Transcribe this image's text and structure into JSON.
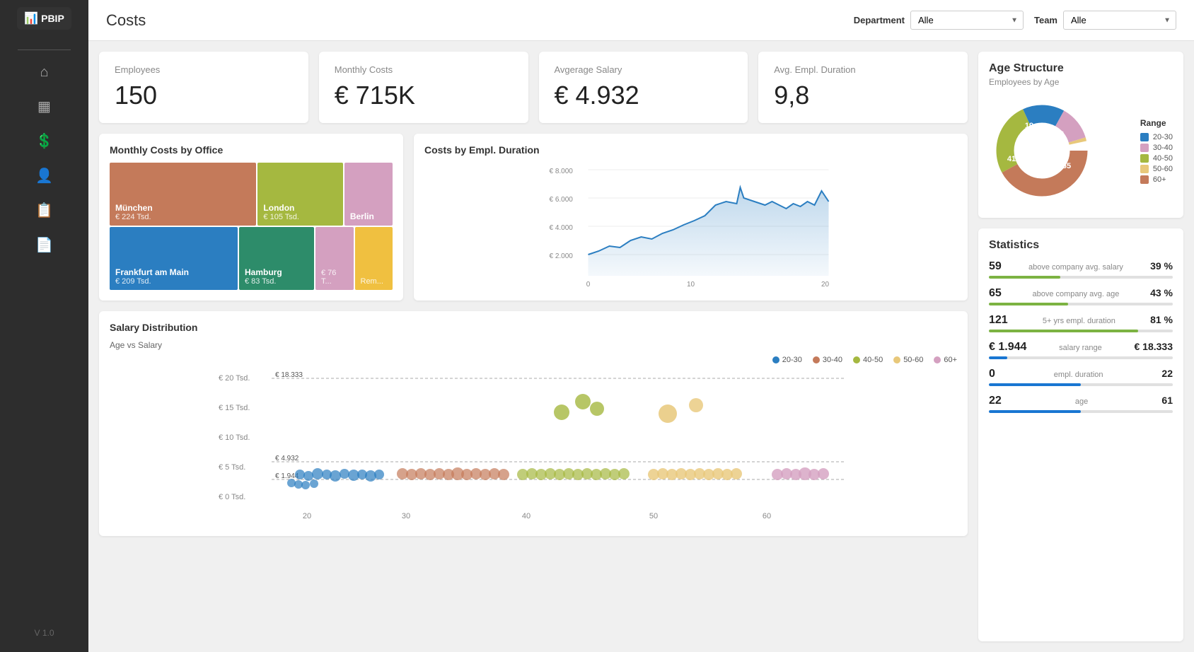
{
  "sidebar": {
    "logo": "PBIP",
    "version": "V 1.0",
    "items": [
      {
        "name": "home",
        "icon": "⌂",
        "active": false
      },
      {
        "name": "calendar",
        "icon": "📅",
        "active": false
      },
      {
        "name": "costs",
        "icon": "💲",
        "active": true
      },
      {
        "name": "person",
        "icon": "👤",
        "active": false
      },
      {
        "name": "report",
        "icon": "📋",
        "active": false
      },
      {
        "name": "document",
        "icon": "📄",
        "active": false
      }
    ]
  },
  "header": {
    "title": "Costs",
    "department_label": "Department",
    "department_value": "Alle",
    "team_label": "Team",
    "team_value": "Alle"
  },
  "kpis": [
    {
      "label": "Employees",
      "value": "150"
    },
    {
      "label": "Monthly Costs",
      "value": "€ 715K"
    },
    {
      "label": "Avgerage Salary",
      "value": "€ 4.932"
    },
    {
      "label": "Avg. Empl. Duration",
      "value": "9,8"
    }
  ],
  "treemap": {
    "title": "Monthly Costs by Office",
    "cells": [
      {
        "label": "München",
        "value": "€ 224 Tsd.",
        "color": "#c47a5a",
        "flex": 2.2,
        "row": 0
      },
      {
        "label": "London",
        "value": "€ 105 Tsd.",
        "color": "#a5b840",
        "flex": 1.2,
        "row": 0
      },
      {
        "label": "Berlin",
        "value": "",
        "color": "#d4a0c0",
        "flex": 0.6,
        "row": 0
      },
      {
        "label": "Frankfurt am Main",
        "value": "€ 209 Tsd.",
        "color": "#2b7ec1",
        "flex": 2.2,
        "row": 1
      },
      {
        "label": "Hamburg",
        "value": "€ 83 Tsd.",
        "color": "#2d8c6a",
        "flex": 1.2,
        "row": 1
      },
      {
        "label": "76 T...",
        "value": "",
        "color": "#d4a0c0",
        "flex": 0.4,
        "row": 1
      },
      {
        "label": "Rem...",
        "value": "",
        "color": "#f0c040",
        "flex": 0.4,
        "row": 1
      }
    ]
  },
  "line_chart": {
    "title": "Costs by Empl. Duration",
    "y_labels": [
      "€ 8.000",
      "€ 6.000",
      "€ 4.000",
      "€ 2.000"
    ],
    "x_labels": [
      "0",
      "10",
      "20"
    ]
  },
  "age_structure": {
    "title": "Age Structure",
    "subtitle": "Employees by Age",
    "range_label": "Range",
    "segments": [
      {
        "label": "20-30",
        "value": 23,
        "color": "#2b7ec1"
      },
      {
        "label": "30-40",
        "value": 19,
        "color": "#d4a0c0"
      },
      {
        "label": "40-50",
        "value": 41,
        "color": "#a5b840"
      },
      {
        "label": "50-60",
        "value": 2,
        "color": "#e8c87a"
      },
      {
        "label": "60+",
        "value": 65,
        "color": "#c47a5a"
      }
    ]
  },
  "statistics": {
    "title": "Statistics",
    "rows": [
      {
        "number": "59",
        "desc": "above company avg. salary",
        "pct": "39 %",
        "fill": 39,
        "bar": "green"
      },
      {
        "number": "65",
        "desc": "above company avg. age",
        "pct": "43 %",
        "fill": 43,
        "bar": "green"
      },
      {
        "number": "121",
        "desc": "5+ yrs empl. duration",
        "pct": "81 %",
        "fill": 81,
        "bar": "green"
      },
      {
        "number": "€ 1.944",
        "desc": "salary range",
        "pct": "€ 18.333",
        "fill": 10,
        "bar": "blue"
      },
      {
        "number": "0",
        "desc": "empl. duration",
        "pct": "22",
        "fill": 50,
        "bar": "blue"
      },
      {
        "number": "22",
        "desc": "age",
        "pct": "61",
        "fill": 50,
        "bar": "blue"
      }
    ]
  },
  "scatter": {
    "title": "Salary Distribution",
    "subtitle": "Age vs Salary",
    "y_labels": [
      "€ 20 Tsd.",
      "€ 15 Tsd.",
      "€ 10 Tsd.",
      "€ 5 Tsd.",
      "€ 0 Tsd."
    ],
    "x_labels": [
      "20",
      "30",
      "40",
      "50",
      "60"
    ],
    "ref_values": [
      "€ 18.333",
      "€ 4.932",
      "€ 1.944"
    ],
    "legend": [
      {
        "label": "20-30",
        "color": "#2b7ec1"
      },
      {
        "label": "30-40",
        "color": "#c47a5a"
      },
      {
        "label": "40-50",
        "color": "#a5b840"
      },
      {
        "label": "50-60",
        "color": "#e8c87a"
      },
      {
        "label": "60+",
        "color": "#d4a0c0"
      }
    ]
  }
}
